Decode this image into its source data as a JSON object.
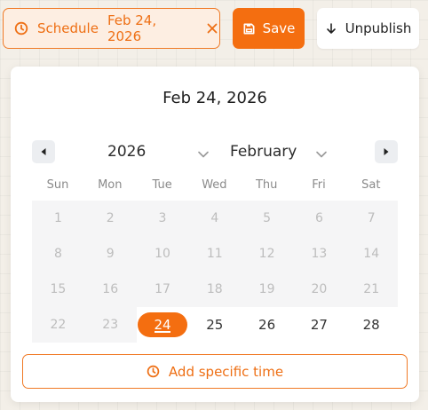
{
  "toolbar": {
    "schedule_label": "Schedule",
    "schedule_date": "Feb 24, 2026",
    "save_label": "Save",
    "unpublish_label": "Unpublish"
  },
  "calendar": {
    "title": "Feb 24, 2026",
    "year": "2026",
    "month": "February",
    "weekdays": [
      "Sun",
      "Mon",
      "Tue",
      "Wed",
      "Thu",
      "Fri",
      "Sat"
    ],
    "days": [
      [
        "1",
        "2",
        "3",
        "4",
        "5",
        "6",
        "7"
      ],
      [
        "8",
        "9",
        "10",
        "11",
        "12",
        "13",
        "14"
      ],
      [
        "15",
        "16",
        "17",
        "18",
        "19",
        "20",
        "21"
      ],
      [
        "22",
        "23",
        "24",
        "25",
        "26",
        "27",
        "28"
      ]
    ],
    "selected_day": "24",
    "first_enabled_day": 24,
    "add_time_label": "Add specific time"
  },
  "colors": {
    "accent": "#f46e10",
    "accent_border": "#f07a26",
    "disabled_bg": "#f5f5f6"
  },
  "icons": {
    "schedule": "clock-icon",
    "close": "close-icon",
    "save": "floppy-disk-icon",
    "unpublish": "arrow-down-icon",
    "prev": "triangle-left-icon",
    "next": "triangle-right-icon",
    "dropdown": "chevron-down-icon",
    "add_time": "clock-icon"
  }
}
